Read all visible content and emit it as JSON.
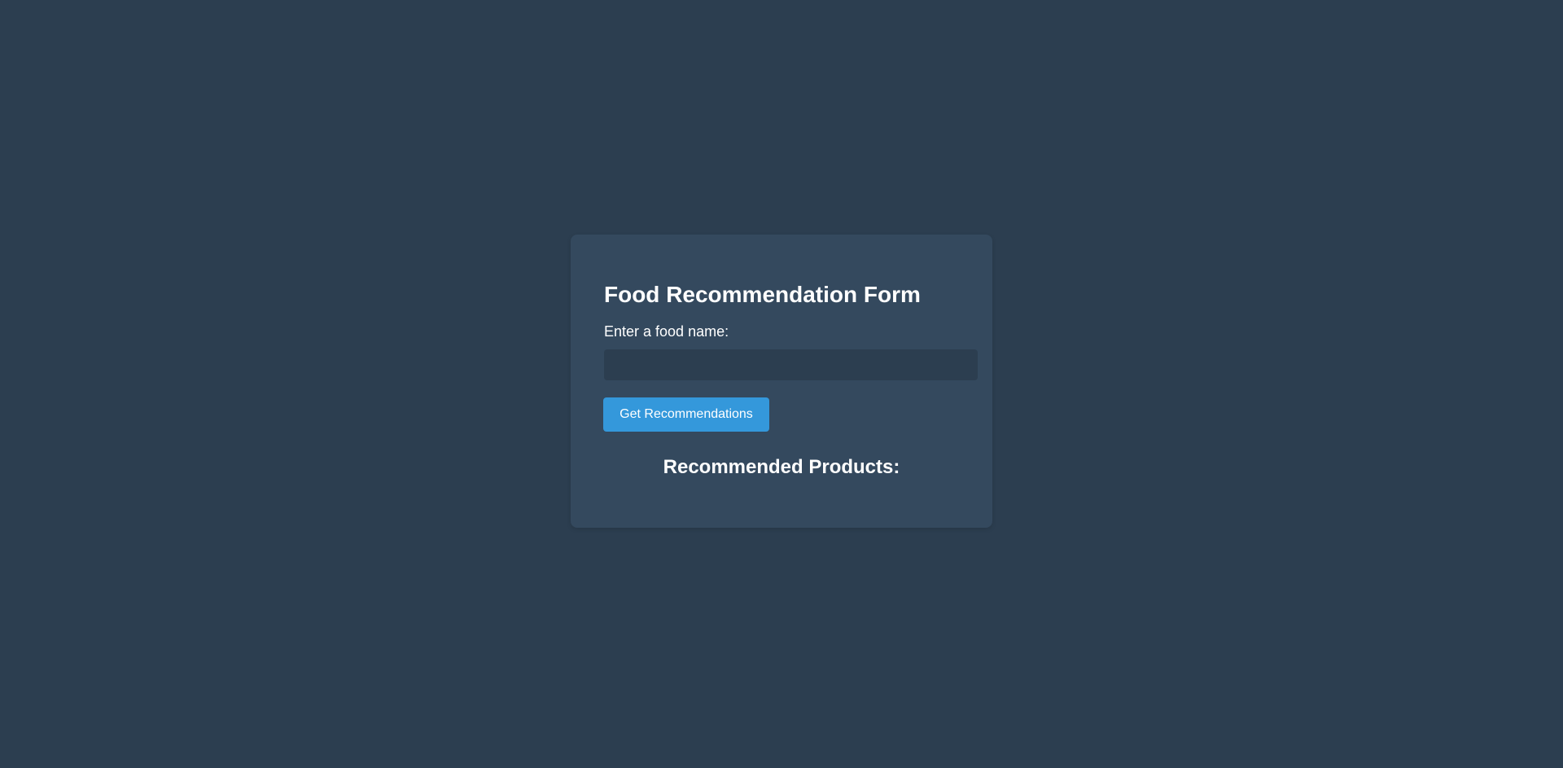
{
  "form": {
    "title": "Food Recommendation Form",
    "input_label": "Enter a food name:",
    "input_value": "",
    "input_placeholder": "",
    "submit_label": "Get Recommendations"
  },
  "results": {
    "heading": "Recommended Products:",
    "items": []
  },
  "colors": {
    "page_background": "#2c3e50",
    "card_background": "#34495e",
    "input_background": "#2c3e50",
    "button_background": "#3498db",
    "text": "#ffffff"
  }
}
